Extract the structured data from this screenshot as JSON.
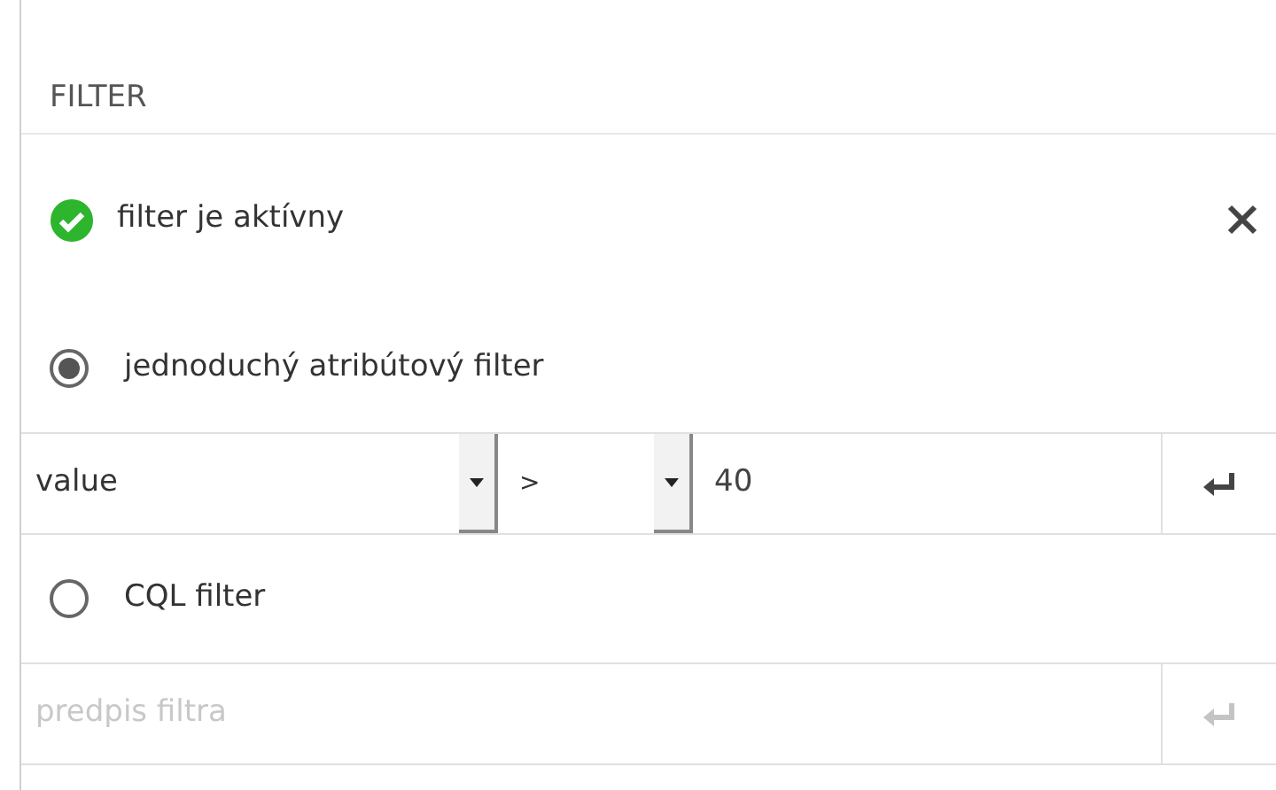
{
  "panel": {
    "title": "FILTER"
  },
  "status": {
    "label": "filter je aktívny",
    "active": true
  },
  "modes": [
    {
      "kind": "attribute",
      "label": "jednoduchý atribútový filter",
      "selected": true,
      "attribute": "value",
      "operator": ">",
      "value": "40"
    },
    {
      "kind": "cql",
      "label": "CQL filter",
      "selected": false,
      "placeholder": "predpis filtra"
    }
  ]
}
